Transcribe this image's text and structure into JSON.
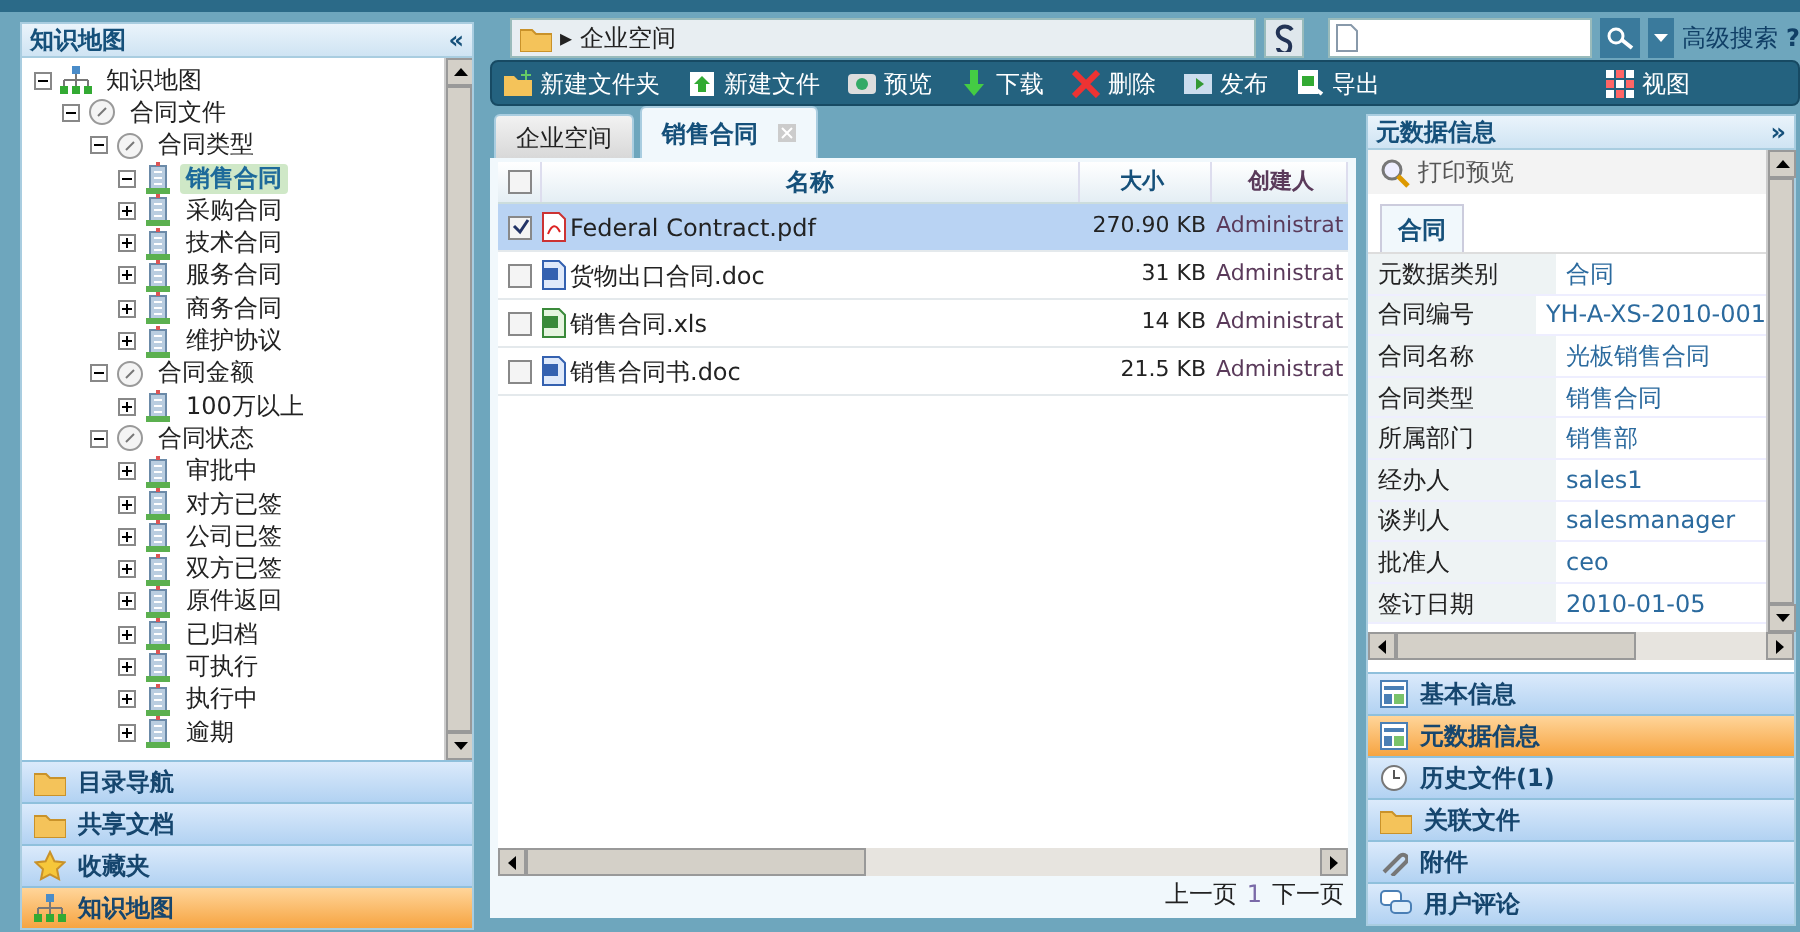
{
  "left_panel": {
    "title": "知识地图",
    "collapse": "«",
    "tree": [
      {
        "label": "知识地图",
        "kind": "root",
        "expanded": true,
        "selected": false,
        "children": [
          {
            "label": "合同文件",
            "kind": "category",
            "expanded": true,
            "selected": false,
            "children": [
              {
                "label": "合同类型",
                "kind": "category",
                "expanded": true,
                "selected": false,
                "children": [
                  {
                    "label": "销售合同",
                    "kind": "leaf",
                    "expanded": true,
                    "selected": true
                  },
                  {
                    "label": "采购合同",
                    "kind": "leaf",
                    "expanded": false,
                    "selected": false
                  },
                  {
                    "label": "技术合同",
                    "kind": "leaf",
                    "expanded": false,
                    "selected": false
                  },
                  {
                    "label": "服务合同",
                    "kind": "leaf",
                    "expanded": false,
                    "selected": false
                  },
                  {
                    "label": "商务合同",
                    "kind": "leaf",
                    "expanded": false,
                    "selected": false
                  },
                  {
                    "label": "维护协议",
                    "kind": "leaf",
                    "expanded": false,
                    "selected": false
                  }
                ]
              },
              {
                "label": "合同金额",
                "kind": "category",
                "expanded": true,
                "selected": false,
                "children": [
                  {
                    "label": "100万以上",
                    "kind": "leaf",
                    "expanded": false,
                    "selected": false
                  }
                ]
              },
              {
                "label": "合同状态",
                "kind": "category",
                "expanded": true,
                "selected": false,
                "children": [
                  {
                    "label": "审批中",
                    "kind": "leaf",
                    "expanded": false,
                    "selected": false
                  },
                  {
                    "label": "对方已签",
                    "kind": "leaf",
                    "expanded": false,
                    "selected": false
                  },
                  {
                    "label": "公司已签",
                    "kind": "leaf",
                    "expanded": false,
                    "selected": false
                  },
                  {
                    "label": "双方已签",
                    "kind": "leaf",
                    "expanded": false,
                    "selected": false
                  },
                  {
                    "label": "原件返回",
                    "kind": "leaf",
                    "expanded": false,
                    "selected": false
                  },
                  {
                    "label": "已归档",
                    "kind": "leaf",
                    "expanded": false,
                    "selected": false
                  },
                  {
                    "label": "可执行",
                    "kind": "leaf",
                    "expanded": false,
                    "selected": false
                  },
                  {
                    "label": "执行中",
                    "kind": "leaf",
                    "expanded": false,
                    "selected": false
                  },
                  {
                    "label": "逾期",
                    "kind": "leaf",
                    "expanded": false,
                    "selected": false
                  }
                ]
              }
            ]
          }
        ]
      }
    ],
    "accordion": [
      {
        "label": "目录导航",
        "kind": "folder",
        "selected": false
      },
      {
        "label": "共享文档",
        "kind": "folder",
        "selected": false
      },
      {
        "label": "收藏夹",
        "kind": "star",
        "selected": false
      },
      {
        "label": "知识地图",
        "kind": "network",
        "selected": true
      }
    ]
  },
  "address_bar": {
    "arrow": "▸",
    "path": "企业空间"
  },
  "search": {
    "advanced": "高级搜索",
    "help": "?"
  },
  "toolbar": [
    {
      "label": "新建文件夹",
      "kind": "new-folder"
    },
    {
      "label": "新建文件",
      "kind": "new-file"
    },
    {
      "label": "预览",
      "kind": "preview"
    },
    {
      "label": "下载",
      "kind": "download"
    },
    {
      "label": "删除",
      "kind": "delete"
    },
    {
      "label": "发布",
      "kind": "publish"
    },
    {
      "label": "导出",
      "kind": "export"
    }
  ],
  "view_button": {
    "label": "视图"
  },
  "tabs": [
    {
      "label": "企业空间",
      "selected": false,
      "closable": false
    },
    {
      "label": "销售合同",
      "selected": true,
      "closable": true
    }
  ],
  "table": {
    "select_all": false,
    "columns": [
      "名称",
      "大小",
      "创建人"
    ],
    "rows": [
      {
        "kind": "pdf",
        "name": "Federal Contract.pdf",
        "size": "270.90 KB",
        "creator": "Administrat",
        "selected": true
      },
      {
        "kind": "doc",
        "name": "货物出口合同.doc",
        "size": "31 KB",
        "creator": "Administrat",
        "selected": false
      },
      {
        "kind": "xls",
        "name": "销售合同.xls",
        "size": "14 KB",
        "creator": "Administrat",
        "selected": false
      },
      {
        "kind": "doc",
        "name": "销售合同书.doc",
        "size": "21.5 KB",
        "creator": "Administrat",
        "selected": false
      }
    ]
  },
  "pager": {
    "prev": "上一页",
    "page": "1",
    "next": "下一页"
  },
  "right_panel": {
    "title": "元数据信息",
    "expand": "»",
    "print_preview": "打印预览",
    "tabs": [
      {
        "label": "合同",
        "selected": true
      }
    ],
    "properties": [
      {
        "label": "元数据类别",
        "value": "合同"
      },
      {
        "label": "合同编号",
        "value": "YH-A-XS-2010-001"
      },
      {
        "label": "合同名称",
        "value": "光板销售合同"
      },
      {
        "label": "合同类型",
        "value": "销售合同"
      },
      {
        "label": "所属部门",
        "value": "销售部"
      },
      {
        "label": "经办人",
        "value": "sales1"
      },
      {
        "label": "谈判人",
        "value": "salesmanager"
      },
      {
        "label": "批准人",
        "value": "ceo"
      },
      {
        "label": "签订日期",
        "value": "2010-01-05"
      }
    ],
    "accordion": [
      {
        "label": "基本信息",
        "kind": "form",
        "selected": false
      },
      {
        "label": "元数据信息",
        "kind": "form",
        "selected": true
      },
      {
        "label": "历史文件(1)",
        "kind": "clock",
        "selected": false
      },
      {
        "label": "关联文件",
        "kind": "folder",
        "selected": false
      },
      {
        "label": "附件",
        "kind": "clip",
        "selected": false
      },
      {
        "label": "用户评论",
        "kind": "comment",
        "selected": false
      }
    ]
  }
}
